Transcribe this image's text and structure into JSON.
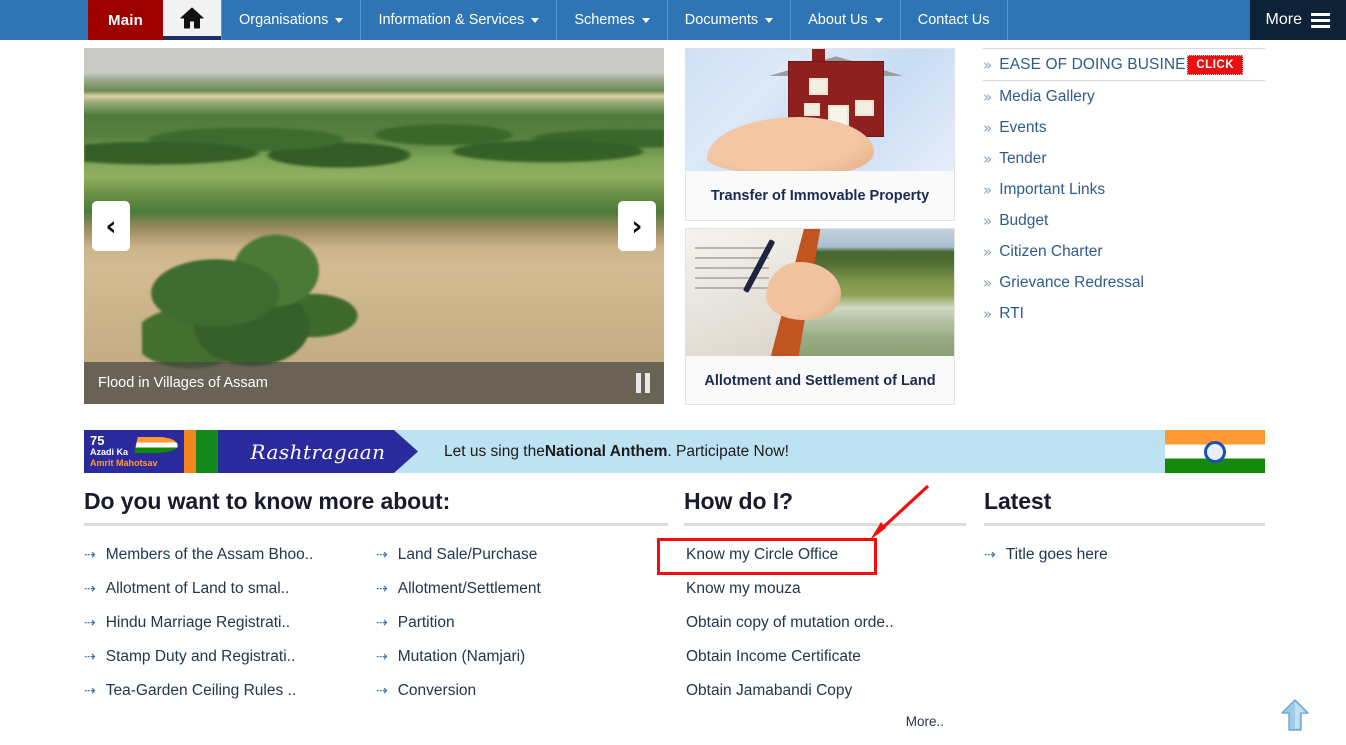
{
  "nav": {
    "main_label": "Main",
    "home_icon": "home-icon",
    "items": [
      {
        "label": "Organisations",
        "has_caret": true
      },
      {
        "label": "Information & Services",
        "has_caret": true
      },
      {
        "label": "Schemes",
        "has_caret": true
      },
      {
        "label": "Documents",
        "has_caret": true
      },
      {
        "label": "About Us",
        "has_caret": true
      },
      {
        "label": "Contact Us",
        "has_caret": false
      }
    ],
    "more_label": "More"
  },
  "carousel": {
    "caption": "Flood in Villages of Assam",
    "prev_icon": "‹",
    "next_icon": "›",
    "pause_icon": "pause-icon"
  },
  "cards": [
    {
      "title": "Transfer of Immovable Property",
      "image": "hand-holding-house-image"
    },
    {
      "title": "Allotment and Settlement of Land",
      "image": "signing-document-field-image"
    }
  ],
  "sidelinks": {
    "chevron": "»",
    "badge_label": "CLICK",
    "items": [
      "EASE OF DOING BUSINESS",
      "Media Gallery",
      "Events",
      "Tender",
      "Important Links",
      "Budget",
      "Citizen Charter",
      "Grievance Redressal",
      "RTI"
    ]
  },
  "banner": {
    "azadi_75": "75",
    "azadi_line1": "Azadi Ka",
    "azadi_line2": "Amrit Mahotsav",
    "rashtragaan": "Rashtragaan",
    "message_pre": "Let us sing the ",
    "message_bold": "National Anthem",
    "message_post": ". Participate Now!"
  },
  "know": {
    "heading": "Do you want to know more about:",
    "arrow": "⇢",
    "left_items": [
      "Members of the Assam Bhoo..",
      "Allotment of Land to smal..",
      "Hindu Marriage Registrati..",
      "Stamp Duty and Registrati..",
      "Tea-Garden Ceiling Rules .."
    ],
    "right_items": [
      "Land Sale/Purchase",
      "Allotment/Settlement",
      "Partition",
      "Mutation (Namjari)",
      "Conversion"
    ]
  },
  "how": {
    "heading": "How do I?",
    "items": [
      "Know my Circle Office",
      "Know my mouza",
      "Obtain copy of mutation orde..",
      "Obtain Income Certificate",
      "Obtain Jamabandi Copy"
    ],
    "more_label": "More.."
  },
  "latest": {
    "heading": "Latest",
    "arrow": "⇢",
    "items": [
      "Title goes here"
    ]
  },
  "annotation": {
    "highlight_target": "Know my Circle Office",
    "color": "#f60c0c"
  },
  "to_top": {
    "icon": "arrow-up-icon"
  },
  "colors": {
    "nav_blue": "#2f75b5",
    "nav_main_red": "#9e0000",
    "nav_more_dark": "#0d2137",
    "link_blue": "#2e5c8a",
    "badge_red": "#e81010",
    "banner_bg": "#bde3f2",
    "azadi_blue": "#2b2a9c"
  }
}
